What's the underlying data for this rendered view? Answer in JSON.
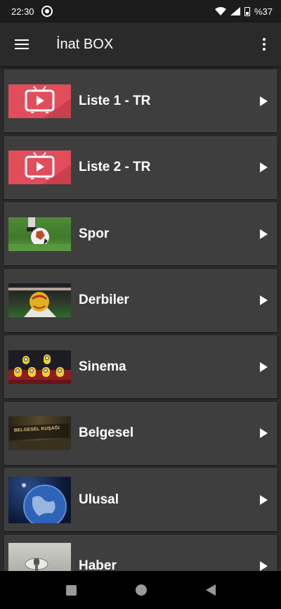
{
  "status_bar": {
    "time": "22:30",
    "battery_text": "%37",
    "icons": [
      "notification-icon",
      "wifi-icon",
      "signal-icon",
      "battery-icon"
    ]
  },
  "app_bar": {
    "title": "İnat BOX",
    "menu_icon": "hamburger-menu-icon",
    "overflow_icon": "more-vert-icon"
  },
  "categories": [
    {
      "label": "Liste 1 - TR",
      "thumb": "tv-play-logo"
    },
    {
      "label": "Liste 2 - TR",
      "thumb": "tv-play-logo"
    },
    {
      "label": "Spor",
      "thumb": "football-on-grass"
    },
    {
      "label": "Derbiler",
      "thumb": "ball-in-stadium"
    },
    {
      "label": "Sinema",
      "thumb": "minions-cinema"
    },
    {
      "label": "Belgesel",
      "thumb": "belgesel-kusagi-banner"
    },
    {
      "label": "Ulusal",
      "thumb": "earth-globe"
    },
    {
      "label": "Haber",
      "thumb": "microphone"
    }
  ],
  "thumb_banner_text": "BELGESEL KUŞAĞI",
  "colors": {
    "background": "#2b2b2b",
    "card": "#3e3e3e",
    "app_bar": "#2a2a2a",
    "tv_logo_red": "#e24d5c"
  },
  "nav_bar": {
    "icons": [
      "recents-square-icon",
      "home-circle-icon",
      "back-triangle-icon"
    ]
  }
}
